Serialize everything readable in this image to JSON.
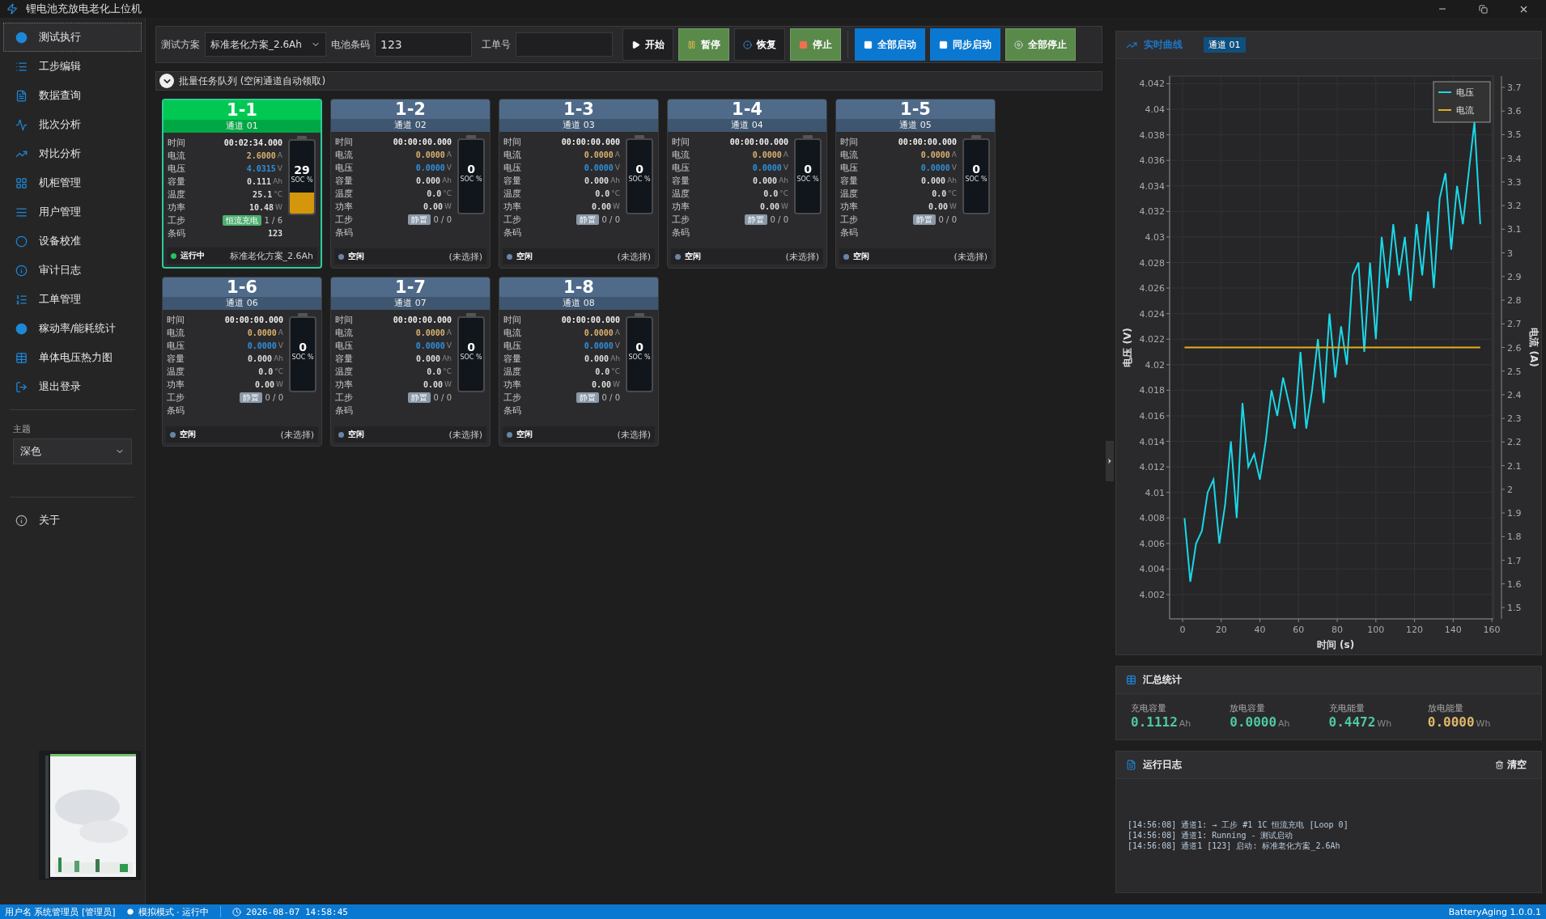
{
  "window": {
    "title": "锂电池充放电老化上位机"
  },
  "sidebar": {
    "items": [
      {
        "label": "测试执行",
        "selected": true
      },
      {
        "label": "工步编辑",
        "selected": false
      },
      {
        "label": "数据查询",
        "selected": false
      },
      {
        "label": "批次分析",
        "selected": false
      },
      {
        "label": "对比分析",
        "selected": false
      },
      {
        "label": "机柜管理",
        "selected": false
      },
      {
        "label": "用户管理",
        "selected": false
      },
      {
        "label": "设备校准",
        "selected": false
      },
      {
        "label": "审计日志",
        "selected": false
      },
      {
        "label": "工单管理",
        "selected": false
      },
      {
        "label": "稼动率/能耗统计",
        "selected": false
      },
      {
        "label": "单体电压热力图",
        "selected": false
      },
      {
        "label": "退出登录",
        "selected": false
      }
    ],
    "theme": {
      "label": "主题",
      "value": "深色"
    },
    "about": "关于"
  },
  "toolbar": {
    "plan_label": "测试方案",
    "plan_value": "标准老化方案_2.6Ah",
    "barcode_label": "电池条码",
    "barcode_value": "123",
    "order_label": "工单号",
    "buttons": [
      {
        "label": "开始",
        "kind": "dark"
      },
      {
        "label": "暂停",
        "kind": "green"
      },
      {
        "label": "恢复",
        "kind": "dark"
      },
      {
        "label": "停止",
        "kind": "green"
      },
      {
        "label": "全部启动",
        "kind": "blue"
      },
      {
        "label": "同步启动",
        "kind": "blue"
      },
      {
        "label": "全部停止",
        "kind": "green"
      }
    ]
  },
  "queue": {
    "title": "批量任务队列 (空闲通道自动领取)",
    "expanded": true
  },
  "channels": [
    {
      "name": "1-1",
      "subtitle": "通道 01",
      "running": true,
      "soc": "29",
      "soc_label": "SOC %",
      "level": 0.29,
      "status": "运行中",
      "plan": "标准老化方案_2.6Ah",
      "rows": [
        {
          "label": "时间",
          "value": "00:02:34.000",
          "kind": "time"
        },
        {
          "label": "电流",
          "value": "2.6000",
          "unit": "A",
          "kind": "current"
        },
        {
          "label": "电压",
          "value": "4.0315",
          "unit": "V",
          "kind": "voltage"
        },
        {
          "label": "容量",
          "value": "0.111",
          "unit": "Ah",
          "kind": "reading"
        },
        {
          "label": "温度",
          "value": "25.1",
          "unit": "°C",
          "kind": "reading"
        },
        {
          "label": "功率",
          "value": "10.48",
          "unit": "W",
          "kind": "reading"
        },
        {
          "label": "工步",
          "badge": "恒流充电",
          "value": "1 / 6",
          "kind": "step"
        },
        {
          "label": "条码",
          "value": "123",
          "kind": "reading"
        }
      ]
    },
    {
      "name": "1-2",
      "subtitle": "通道 02",
      "running": false,
      "soc": "0",
      "soc_label": "SOC %",
      "level": 0,
      "status": "空闲",
      "plan": "(未选择)",
      "rows": [
        {
          "label": "时间",
          "value": "00:00:00.000",
          "kind": "time"
        },
        {
          "label": "电流",
          "value": "0.0000",
          "unit": "A",
          "kind": "current"
        },
        {
          "label": "电压",
          "value": "0.0000",
          "unit": "V",
          "kind": "voltage"
        },
        {
          "label": "容量",
          "value": "0.000",
          "unit": "Ah",
          "kind": "reading"
        },
        {
          "label": "温度",
          "value": "0.0",
          "unit": "°C",
          "kind": "reading"
        },
        {
          "label": "功率",
          "value": "0.00",
          "unit": "W",
          "kind": "reading"
        },
        {
          "label": "工步",
          "badge": "静置",
          "value": "0 / 0",
          "kind": "step"
        },
        {
          "label": "条码",
          "kind": "reading"
        }
      ]
    },
    {
      "name": "1-3",
      "subtitle": "通道 03",
      "running": false,
      "soc": "0",
      "soc_label": "SOC %",
      "level": 0,
      "status": "空闲",
      "plan": "(未选择)",
      "rows": [
        {
          "label": "时间",
          "value": "00:00:00.000",
          "kind": "time"
        },
        {
          "label": "电流",
          "value": "0.0000",
          "unit": "A",
          "kind": "current"
        },
        {
          "label": "电压",
          "value": "0.0000",
          "unit": "V",
          "kind": "voltage"
        },
        {
          "label": "容量",
          "value": "0.000",
          "unit": "Ah",
          "kind": "reading"
        },
        {
          "label": "温度",
          "value": "0.0",
          "unit": "°C",
          "kind": "reading"
        },
        {
          "label": "功率",
          "value": "0.00",
          "unit": "W",
          "kind": "reading"
        },
        {
          "label": "工步",
          "badge": "静置",
          "value": "0 / 0",
          "kind": "step"
        },
        {
          "label": "条码",
          "kind": "reading"
        }
      ]
    },
    {
      "name": "1-4",
      "subtitle": "通道 04",
      "running": false,
      "soc": "0",
      "soc_label": "SOC %",
      "level": 0,
      "status": "空闲",
      "plan": "(未选择)",
      "rows": [
        {
          "label": "时间",
          "value": "00:00:00.000",
          "kind": "time"
        },
        {
          "label": "电流",
          "value": "0.0000",
          "unit": "A",
          "kind": "current"
        },
        {
          "label": "电压",
          "value": "0.0000",
          "unit": "V",
          "kind": "voltage"
        },
        {
          "label": "容量",
          "value": "0.000",
          "unit": "Ah",
          "kind": "reading"
        },
        {
          "label": "温度",
          "value": "0.0",
          "unit": "°C",
          "kind": "reading"
        },
        {
          "label": "功率",
          "value": "0.00",
          "unit": "W",
          "kind": "reading"
        },
        {
          "label": "工步",
          "badge": "静置",
          "value": "0 / 0",
          "kind": "step"
        },
        {
          "label": "条码",
          "kind": "reading"
        }
      ]
    },
    {
      "name": "1-5",
      "subtitle": "通道 05",
      "running": false,
      "soc": "0",
      "soc_label": "SOC %",
      "level": 0,
      "status": "空闲",
      "plan": "(未选择)",
      "rows": [
        {
          "label": "时间",
          "value": "00:00:00.000",
          "kind": "time"
        },
        {
          "label": "电流",
          "value": "0.0000",
          "unit": "A",
          "kind": "current"
        },
        {
          "label": "电压",
          "value": "0.0000",
          "unit": "V",
          "kind": "voltage"
        },
        {
          "label": "容量",
          "value": "0.000",
          "unit": "Ah",
          "kind": "reading"
        },
        {
          "label": "温度",
          "value": "0.0",
          "unit": "°C",
          "kind": "reading"
        },
        {
          "label": "功率",
          "value": "0.00",
          "unit": "W",
          "kind": "reading"
        },
        {
          "label": "工步",
          "badge": "静置",
          "value": "0 / 0",
          "kind": "step"
        },
        {
          "label": "条码",
          "kind": "reading"
        }
      ]
    },
    {
      "name": "1-6",
      "subtitle": "通道 06",
      "running": false,
      "soc": "0",
      "soc_label": "SOC %",
      "level": 0,
      "status": "空闲",
      "plan": "(未选择)",
      "rows": [
        {
          "label": "时间",
          "value": "00:00:00.000",
          "kind": "time"
        },
        {
          "label": "电流",
          "value": "0.0000",
          "unit": "A",
          "kind": "current"
        },
        {
          "label": "电压",
          "value": "0.0000",
          "unit": "V",
          "kind": "voltage"
        },
        {
          "label": "容量",
          "value": "0.000",
          "unit": "Ah",
          "kind": "reading"
        },
        {
          "label": "温度",
          "value": "0.0",
          "unit": "°C",
          "kind": "reading"
        },
        {
          "label": "功率",
          "value": "0.00",
          "unit": "W",
          "kind": "reading"
        },
        {
          "label": "工步",
          "badge": "静置",
          "value": "0 / 0",
          "kind": "step"
        },
        {
          "label": "条码",
          "kind": "reading"
        }
      ]
    },
    {
      "name": "1-7",
      "subtitle": "通道 07",
      "running": false,
      "soc": "0",
      "soc_label": "SOC %",
      "level": 0,
      "status": "空闲",
      "plan": "(未选择)",
      "rows": [
        {
          "label": "时间",
          "value": "00:00:00.000",
          "kind": "time"
        },
        {
          "label": "电流",
          "value": "0.0000",
          "unit": "A",
          "kind": "current"
        },
        {
          "label": "电压",
          "value": "0.0000",
          "unit": "V",
          "kind": "voltage"
        },
        {
          "label": "容量",
          "value": "0.000",
          "unit": "Ah",
          "kind": "reading"
        },
        {
          "label": "温度",
          "value": "0.0",
          "unit": "°C",
          "kind": "reading"
        },
        {
          "label": "功率",
          "value": "0.00",
          "unit": "W",
          "kind": "reading"
        },
        {
          "label": "工步",
          "badge": "静置",
          "value": "0 / 0",
          "kind": "step"
        },
        {
          "label": "条码",
          "kind": "reading"
        }
      ]
    },
    {
      "name": "1-8",
      "subtitle": "通道 08",
      "running": false,
      "soc": "0",
      "soc_label": "SOC %",
      "level": 0,
      "status": "空闲",
      "plan": "(未选择)",
      "rows": [
        {
          "label": "时间",
          "value": "00:00:00.000",
          "kind": "time"
        },
        {
          "label": "电流",
          "value": "0.0000",
          "unit": "A",
          "kind": "current"
        },
        {
          "label": "电压",
          "value": "0.0000",
          "unit": "V",
          "kind": "voltage"
        },
        {
          "label": "容量",
          "value": "0.000",
          "unit": "Ah",
          "kind": "reading"
        },
        {
          "label": "温度",
          "value": "0.0",
          "unit": "°C",
          "kind": "reading"
        },
        {
          "label": "功率",
          "value": "0.00",
          "unit": "W",
          "kind": "reading"
        },
        {
          "label": "工步",
          "badge": "静置",
          "value": "0 / 0",
          "kind": "step"
        },
        {
          "label": "条码",
          "kind": "reading"
        }
      ]
    }
  ],
  "chart_panel": {
    "title": "实时曲线",
    "tab": "通道 01",
    "chart_data": {
      "type": "line",
      "xlabel": "时间 (s)",
      "ylabel": "电压 (V)",
      "y2label": "电流 (A)",
      "x": [
        1,
        4,
        7,
        10,
        13,
        16,
        19,
        22,
        25,
        28,
        31,
        34,
        37,
        40,
        43,
        46,
        49,
        52,
        55,
        58,
        61,
        64,
        67,
        70,
        73,
        76,
        79,
        82,
        85,
        88,
        91,
        94,
        97,
        100,
        103,
        106,
        109,
        112,
        115,
        118,
        121,
        124,
        127,
        130,
        133,
        136,
        139,
        142,
        145,
        148,
        151,
        154
      ],
      "grid": true,
      "legend": "upper right",
      "xlim": [
        -6.7,
        160.8
      ],
      "ylim": [
        4.0001,
        4.0426
      ],
      "y2lim": [
        1.452,
        3.748
      ],
      "xticks": [
        0,
        20,
        40,
        60,
        80,
        100,
        120,
        140,
        160
      ],
      "yticks": [
        4.002,
        4.004,
        4.006,
        4.008,
        4.01,
        4.012,
        4.014,
        4.016,
        4.018,
        4.02,
        4.022,
        4.024,
        4.026,
        4.028,
        4.03,
        4.032,
        4.034,
        4.036,
        4.038,
        4.04,
        4.042
      ],
      "y2ticks": [
        1.5,
        1.6,
        1.7,
        1.8,
        1.9,
        2,
        2.1,
        2.2,
        2.3,
        2.4,
        2.5,
        2.6,
        2.7,
        2.8,
        2.9,
        3,
        3.1,
        3.2,
        3.3,
        3.4,
        3.5,
        3.6,
        3.7
      ],
      "series": [
        {
          "name": "电压",
          "color": "#1ad8e8",
          "values": [
            4.008,
            4.003,
            4.006,
            4.007,
            4.01,
            4.011,
            4.006,
            4.009,
            4.014,
            4.008,
            4.017,
            4.012,
            4.013,
            4.011,
            4.014,
            4.018,
            4.016,
            4.019,
            4.017,
            4.015,
            4.021,
            4.015,
            4.018,
            4.022,
            4.017,
            4.024,
            4.019,
            4.023,
            4.02,
            4.027,
            4.028,
            4.021,
            4.028,
            4.022,
            4.03,
            4.026,
            4.031,
            4.027,
            4.03,
            4.025,
            4.031,
            4.027,
            4.032,
            4.026,
            4.033,
            4.035,
            4.029,
            4.034,
            4.031,
            4.035,
            4.039,
            4.031
          ]
        },
        {
          "name": "电流",
          "color": "#e0b020",
          "axis": "y2",
          "values": [
            2.6,
            2.6,
            2.6,
            2.6,
            2.6,
            2.6,
            2.6,
            2.6,
            2.6,
            2.6,
            2.6,
            2.6,
            2.6,
            2.6,
            2.6,
            2.6,
            2.6,
            2.6,
            2.6,
            2.6,
            2.6,
            2.6,
            2.6,
            2.6,
            2.6,
            2.6,
            2.6,
            2.6,
            2.6,
            2.6,
            2.6,
            2.6,
            2.6,
            2.6,
            2.6,
            2.6,
            2.6,
            2.6,
            2.6,
            2.6,
            2.6,
            2.6,
            2.6,
            2.6,
            2.6,
            2.6,
            2.6,
            2.6,
            2.6,
            2.6,
            2.6,
            2.6
          ]
        }
      ]
    }
  },
  "summary": {
    "title": "汇总统计",
    "stats": [
      {
        "label": "充电容量",
        "value": "0.1112",
        "unit": "Ah",
        "color": "#4ec9a0"
      },
      {
        "label": "放电容量",
        "value": "0.0000",
        "unit": "Ah",
        "color": "#4ec9a0"
      },
      {
        "label": "充电能量",
        "value": "0.4472",
        "unit": "Wh",
        "color": "#4ec9a0"
      },
      {
        "label": "放电能量",
        "value": "0.0000",
        "unit": "Wh",
        "color": "#e0b86a"
      }
    ]
  },
  "log": {
    "title": "运行日志",
    "clear": "清空",
    "lines": [
      "[14:56:08] 通道1: → 工步 #1 1C 恒流充电 [Loop 0]",
      "[14:56:08] 通道1: Running - 测试启动",
      "[14:56:08] 通道1 [123] 启动: 标准老化方案_2.6Ah"
    ]
  },
  "status_bar": {
    "user": "用户名 系统管理员 [管理员]",
    "mode": "模拟模式 · 运行中",
    "time": "2026-08-07 14:58:45",
    "version": "BatteryAging 1.0.0.1"
  }
}
